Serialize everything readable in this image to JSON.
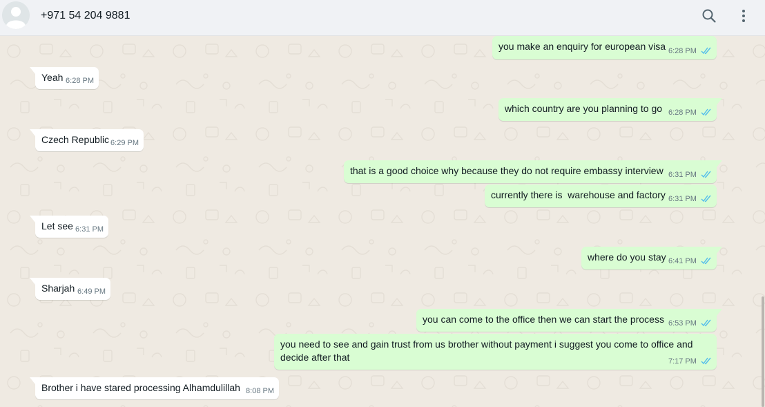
{
  "header": {
    "contact": "+971 54 204 9881",
    "search_icon": "search-icon",
    "menu_icon": "more-vertical-icon"
  },
  "colors": {
    "incoming_bubble": "#ffffff",
    "outgoing_bubble": "#d9fdd3",
    "read_ticks": "#53bdeb",
    "chat_background": "#efeae2",
    "header_background": "#f0f2f5"
  },
  "messages": [
    {
      "direction": "out",
      "text": "you make an enquiry for european visa",
      "time": "6:28 PM",
      "status": "read"
    },
    {
      "direction": "in",
      "text": "Yeah",
      "time": "6:28 PM"
    },
    {
      "direction": "out",
      "text": "which country are you planning to go",
      "time": "6:28 PM",
      "status": "read"
    },
    {
      "direction": "in",
      "text": "Czech Republic",
      "time": "6:29 PM"
    },
    {
      "direction": "out",
      "text": "that is a good choice why because they do not require embassy interview",
      "time": "6:31 PM",
      "status": "read"
    },
    {
      "direction": "out",
      "text": "currently there is  warehouse and factory",
      "time": "6:31 PM",
      "status": "read"
    },
    {
      "direction": "in",
      "text": "Let see",
      "time": "6:31 PM"
    },
    {
      "direction": "out",
      "text": "where do you stay",
      "time": "6:41 PM",
      "status": "read"
    },
    {
      "direction": "in",
      "text": "Sharjah",
      "time": "6:49 PM"
    },
    {
      "direction": "out",
      "text": "you can come to the office then we can start the process",
      "time": "6:53 PM",
      "status": "read"
    },
    {
      "direction": "out",
      "text": "you need to see and gain trust from us brother without payment i suggest you come to office and decide after that",
      "time": "7:17 PM",
      "status": "read"
    },
    {
      "direction": "in",
      "text": "Brother i have stared processing Alhamdulillah",
      "time": "8:08 PM"
    }
  ]
}
